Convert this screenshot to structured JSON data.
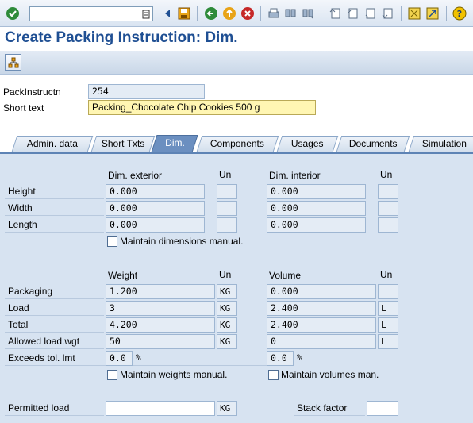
{
  "toolbar": {
    "command_value": "",
    "icons": [
      "enter-check-icon",
      "back-icon",
      "save-icon",
      "back-arrow-icon",
      "exit-icon",
      "cancel-icon",
      "print-icon",
      "find-icon",
      "find-next-icon",
      "first-page-icon",
      "prev-page-icon",
      "next-page-icon",
      "last-page-icon",
      "new-session-icon",
      "shortcut-icon",
      "help-icon"
    ]
  },
  "title": "Create Packing Instruction: Dim.",
  "header": {
    "packinstr_label": "PackInstructn",
    "packinstr_value": "254",
    "short_text_label": "Short text",
    "short_text_value": "Packing_Chocolate Chip Cookies 500 g"
  },
  "tabs": [
    {
      "label": "Admin. data"
    },
    {
      "label": "Short Txts"
    },
    {
      "label": "Dim."
    },
    {
      "label": "Components"
    },
    {
      "label": "Usages"
    },
    {
      "label": "Documents"
    },
    {
      "label": "Simulation"
    }
  ],
  "dims": {
    "exterior_header": "Dim. exterior",
    "interior_header": "Dim. interior",
    "unit_header": "Un",
    "rows": [
      {
        "label": "Height",
        "exterior": "0.000",
        "ext_unit": "",
        "interior": "0.000",
        "int_unit": ""
      },
      {
        "label": "Width",
        "exterior": "0.000",
        "ext_unit": "",
        "interior": "0.000",
        "int_unit": ""
      },
      {
        "label": "Length",
        "exterior": "0.000",
        "ext_unit": "",
        "interior": "0.000",
        "int_unit": ""
      }
    ],
    "maintain_label": "Maintain dimensions manual."
  },
  "weights": {
    "weight_header": "Weight",
    "volume_header": "Volume",
    "unit_header": "Un",
    "rows": [
      {
        "label": "Packaging",
        "weight": "1.200",
        "w_unit": "KG",
        "volume": "0.000",
        "v_unit": ""
      },
      {
        "label": "Load",
        "weight": "3",
        "w_unit": "KG",
        "volume": "2.400",
        "v_unit": "L"
      },
      {
        "label": "Total",
        "weight": "4.200",
        "w_unit": "KG",
        "volume": "2.400",
        "v_unit": "L"
      },
      {
        "label": "Allowed load.wgt",
        "weight": "50",
        "w_unit": "KG",
        "volume": "0",
        "v_unit": "L"
      }
    ],
    "exceeds_label": "Exceeds tol. lmt",
    "exceeds_weight": "0.0",
    "exceeds_volume": "0.0",
    "percent": "%",
    "maintain_weights_label": "Maintain weights manual.",
    "maintain_volumes_label": "Maintain volumes man."
  },
  "permitted": {
    "label": "Permitted load",
    "value": "",
    "unit": "KG",
    "stack_label": "Stack factor",
    "stack_value": ""
  }
}
